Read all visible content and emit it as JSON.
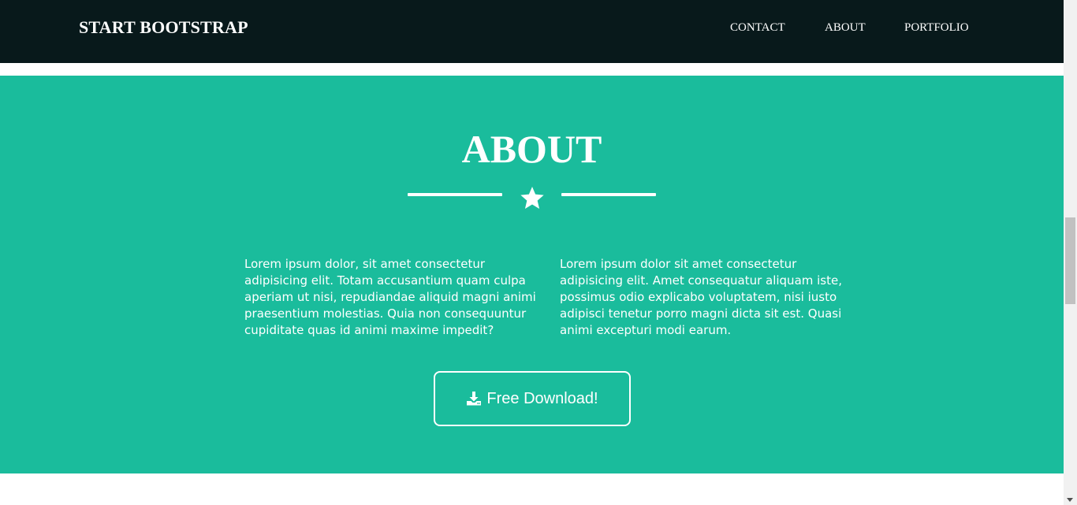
{
  "navbar": {
    "brand": "START BOOTSTRAP",
    "links": [
      {
        "label": "CONTACT"
      },
      {
        "label": "ABOUT"
      },
      {
        "label": "PORTFOLIO"
      }
    ]
  },
  "about": {
    "title": "ABOUT",
    "divider_icon": "star-icon",
    "paragraphs": [
      "Lorem ipsum dolor, sit amet consectetur adipisicing elit. Totam accusantium quam culpa aperiam ut nisi, repudiandae aliquid magni animi praesentium molestias. Quia non consequuntur cupiditate quas id animi maxime impedit?",
      "Lorem ipsum dolor sit amet consectetur adipisicing elit. Amet consequatur aliquam iste, possimus odio explicabo voluptatem, nisi iusto adipisci tenetur porro magni dicta sit est. Quasi animi excepturi modi earum."
    ],
    "download_button": {
      "label": "Free Download!",
      "icon": "download-icon"
    }
  },
  "colors": {
    "navbar_bg": "#08191b",
    "accent": "#1abc9c",
    "text": "#ffffff"
  }
}
